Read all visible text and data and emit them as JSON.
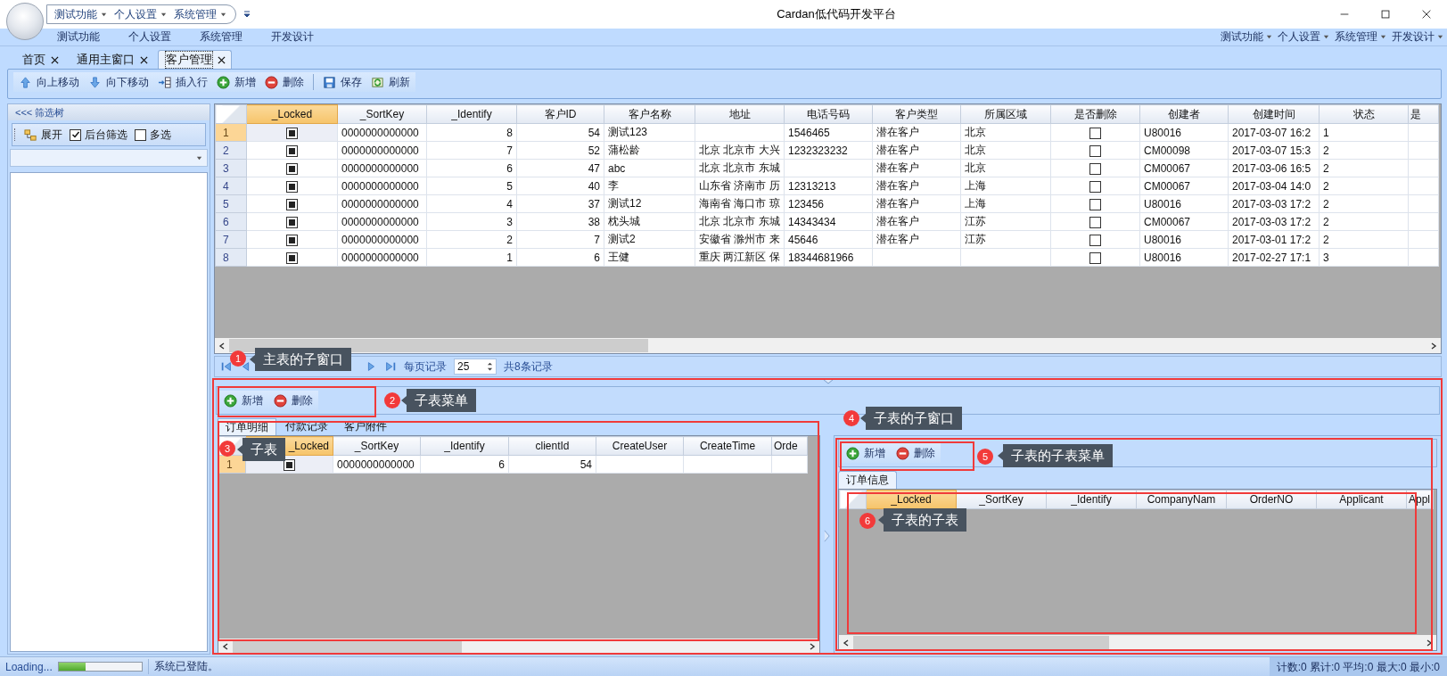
{
  "window": {
    "title": "Cardan低代码开发平台"
  },
  "quick_access": [
    "测试功能",
    "个人设置",
    "系统管理"
  ],
  "ribbon_tabs": [
    "测试功能",
    "个人设置",
    "系统管理",
    "开发设计"
  ],
  "ribbon_menus": [
    "测试功能",
    "个人设置",
    "系统管理",
    "开发设计"
  ],
  "document_tabs": [
    {
      "label": "首页",
      "selected": false
    },
    {
      "label": "通用主窗口",
      "selected": false
    },
    {
      "label": "客户管理",
      "selected": true
    }
  ],
  "toolbar": [
    {
      "kind": "up",
      "label": "向上移动"
    },
    {
      "kind": "down",
      "label": "向下移动"
    },
    {
      "kind": "insert",
      "label": "插入行"
    },
    {
      "kind": "add",
      "label": "新增"
    },
    {
      "kind": "delete",
      "label": "删除"
    },
    {
      "kind": "separator"
    },
    {
      "kind": "save",
      "label": "保存"
    },
    {
      "kind": "refresh",
      "label": "刷新"
    }
  ],
  "filter_tree": {
    "title": "<<< 筛选树",
    "expand_label": "展开",
    "options": [
      {
        "label": "后台筛选",
        "checked": true
      },
      {
        "label": "多选",
        "checked": false
      }
    ]
  },
  "main_grid": {
    "columns": [
      {
        "label": "_Locked",
        "kind": "check",
        "selected": true
      },
      {
        "label": "_SortKey",
        "kind": "text",
        "selected": false
      },
      {
        "label": "_Identify",
        "kind": "number",
        "selected": false
      },
      {
        "label": "客户ID",
        "kind": "number",
        "selected": false
      },
      {
        "label": "客户名称",
        "kind": "text",
        "selected": false
      },
      {
        "label": "地址",
        "kind": "text",
        "selected": false
      },
      {
        "label": "电话号码",
        "kind": "text",
        "selected": false
      },
      {
        "label": "客户类型",
        "kind": "text",
        "selected": false
      },
      {
        "label": "所属区域",
        "kind": "text",
        "selected": false
      },
      {
        "label": "是否删除",
        "kind": "check",
        "selected": false
      },
      {
        "label": "创建者",
        "kind": "text",
        "selected": false
      },
      {
        "label": "创建时间",
        "kind": "text",
        "selected": false
      },
      {
        "label": "状态",
        "kind": "text",
        "selected": false
      },
      {
        "label": "是",
        "selected": false
      }
    ],
    "rows": [
      {
        "number": "1",
        "selected": true,
        "values": [
          true,
          "0000000000000",
          "8",
          "54",
          "测试123",
          {
            "kind": "blank"
          },
          "1546465",
          "潜在客户",
          "北京",
          false,
          "U80016",
          "2017-03-07 16:2",
          "1"
        ]
      },
      {
        "number": "2",
        "selected": false,
        "values": [
          true,
          "0000000000000",
          "7",
          "52",
          "蒲松龄",
          "北京 北京市 大兴",
          "1232323232",
          "潜在客户",
          "北京",
          false,
          "CM00098",
          "2017-03-07 15:3",
          "2"
        ]
      },
      {
        "number": "3",
        "selected": false,
        "values": [
          true,
          "0000000000000",
          "6",
          "47",
          "abc",
          "北京 北京市 东城",
          {
            "kind": "blank"
          },
          "潜在客户",
          "北京",
          false,
          "CM00067",
          "2017-03-06 16:5",
          "2"
        ]
      },
      {
        "number": "4",
        "selected": false,
        "values": [
          true,
          "0000000000000",
          "5",
          "40",
          "李",
          "山东省 济南市 历",
          "12313213",
          "潜在客户",
          "上海",
          false,
          "CM00067",
          "2017-03-04 14:0",
          "2"
        ]
      },
      {
        "number": "5",
        "selected": false,
        "values": [
          true,
          "0000000000000",
          "4",
          "37",
          "测试12",
          "海南省 海口市 琼",
          "123456",
          "潜在客户",
          "上海",
          false,
          "U80016",
          "2017-03-03 17:2",
          "2"
        ]
      },
      {
        "number": "6",
        "selected": false,
        "values": [
          true,
          "0000000000000",
          "3",
          "38",
          "枕头城",
          "北京 北京市 东城",
          "14343434",
          "潜在客户",
          "江苏",
          false,
          "CM00067",
          "2017-03-03 17:2",
          "2"
        ]
      },
      {
        "number": "7",
        "selected": false,
        "values": [
          true,
          "0000000000000",
          "2",
          "7",
          "测试2",
          "安徽省 滁州市 来",
          "45646",
          "潜在客户",
          "江苏",
          false,
          "U80016",
          "2017-03-01 17:2",
          "2"
        ]
      },
      {
        "number": "8",
        "selected": false,
        "values": [
          true,
          "0000000000000",
          "1",
          "6",
          "王健",
          "重庆 两江新区 保",
          "18344681966",
          {
            "kind": "blank"
          },
          {
            "kind": "blank"
          },
          false,
          "U80016",
          "2017-02-27 17:1",
          "3"
        ]
      }
    ]
  },
  "pager": {
    "rows_per_page_label": "每页记录",
    "rows_per_page": "25",
    "total": "共8条记录"
  },
  "sub_toolbar": [
    {
      "kind": "add",
      "label": "新增"
    },
    {
      "kind": "delete",
      "label": "删除"
    }
  ],
  "sub_tabs": [
    {
      "label": "订单明细",
      "selected": true
    },
    {
      "label": "付款记录",
      "selected": false
    },
    {
      "label": "客户附件",
      "selected": false
    }
  ],
  "sub_grid": {
    "columns": [
      {
        "label": "_Locked",
        "kind": "check",
        "selected": true
      },
      {
        "label": "_SortKey",
        "kind": "text",
        "selected": false
      },
      {
        "label": "_Identify",
        "kind": "number",
        "selected": false
      },
      {
        "label": "clientId",
        "kind": "number",
        "selected": false
      },
      {
        "label": "CreateUser",
        "selected": false
      },
      {
        "label": "CreateTime",
        "selected": false
      },
      {
        "label": "Orde",
        "selected": false
      }
    ],
    "rows": [
      {
        "number": "1",
        "selected": true,
        "values": [
          true,
          "0000000000000",
          "6",
          "54"
        ]
      }
    ]
  },
  "detail_toolbar": [
    {
      "kind": "add",
      "label": "新增"
    },
    {
      "kind": "delete",
      "label": "删除"
    }
  ],
  "detail_tabs": [
    {
      "label": "订单信息",
      "selected": true
    }
  ],
  "detail_grid": {
    "columns": [
      {
        "label": "_Locked",
        "selected": true
      },
      {
        "label": "_SortKey",
        "selected": false
      },
      {
        "label": "_Identify",
        "selected": false
      },
      {
        "label": "CompanyNam",
        "selected": false
      },
      {
        "label": "OrderNO",
        "selected": false
      },
      {
        "label": "Applicant",
        "selected": false
      },
      {
        "label": "Appl",
        "selected": false
      }
    ]
  },
  "status_bar": {
    "loading": "Loading...",
    "progress": {
      "level": 0.33
    },
    "message": "系统已登陆。",
    "summary": "计数:0 累计:0 平均:0 最大:0 最小:0"
  },
  "annotations": [
    {
      "number": "1",
      "text": "主表的子窗口"
    },
    {
      "number": "2",
      "text": "子表菜单"
    },
    {
      "number": "3",
      "text": "子表"
    },
    {
      "number": "4",
      "text": "子表的子窗口"
    },
    {
      "number": "5",
      "text": "子表的子表菜单"
    },
    {
      "number": "6",
      "text": "子表的子表"
    }
  ]
}
